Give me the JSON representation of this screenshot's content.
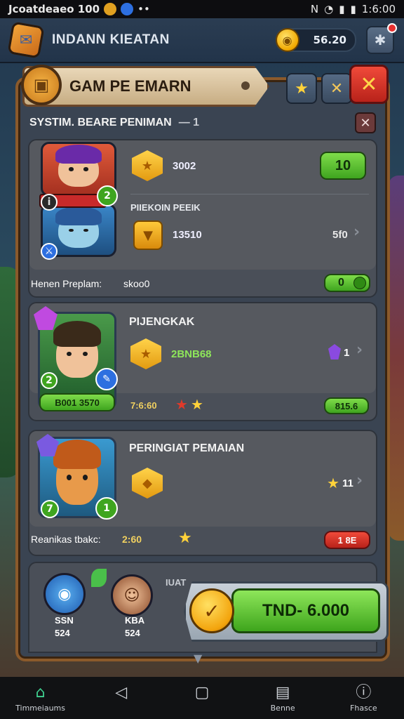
{
  "status_bar": {
    "left_text": "Jcoatdeaeo 100",
    "time": "1:6:00"
  },
  "top_bar": {
    "title": "INDANN KIEATAN",
    "currency_value": "56.20"
  },
  "panel": {
    "header_title": "GAM PE EMARN",
    "subtitle": "SYSTIM. BEARE PENIMAN",
    "subtitle_suffix": "— 1"
  },
  "card1": {
    "hero_badge": "2",
    "row1_value": "3002",
    "row1_button": "10",
    "row2_title": "PIIEKOIN PEEIK",
    "row2_value": "13510",
    "row2_right": "5f0",
    "footer_label": "Henen Preplam:",
    "footer_value": "skoo0",
    "footer_toggle": "0"
  },
  "card2": {
    "title": "PIJENGKAK",
    "hero_tag": "B001 3570",
    "hero_badge_left": "2",
    "reward_value": "2BNB68",
    "gem_count": "1",
    "footer_value": "7:6:60",
    "footer_pill": "815.6"
  },
  "card3": {
    "title": "PERINGIAT PEMAIAN",
    "star_count": "11",
    "hero_badge_left": "7",
    "hero_badge_right": "1",
    "footer_label": "Reanikas tbakc:",
    "footer_value": "2:60",
    "footer_pill": "1 8E"
  },
  "bottom": {
    "label": "IUAT",
    "hero1_name": "SSN",
    "hero1_value": "524",
    "hero2_name": "KBA",
    "hero2_value": "524",
    "claim_label": "TND- 6.000"
  },
  "nav": {
    "items": [
      {
        "label": "Timmeiaums",
        "icon": "home-icon"
      },
      {
        "label": "",
        "icon": "back-icon"
      },
      {
        "label": "",
        "icon": "recents-icon"
      },
      {
        "label": "Benne",
        "icon": "box-icon"
      },
      {
        "label": "Fhasce",
        "icon": "info-icon"
      }
    ]
  },
  "colors": {
    "frame": "#8b5a2b",
    "green": "#3fa51f",
    "red": "#d42a22",
    "gold": "#f0a800"
  }
}
